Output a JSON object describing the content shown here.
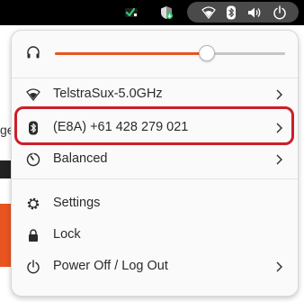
{
  "topbar": {
    "icons": [
      "status-checkmark-icon",
      "shield-update-icon",
      "wifi-icon",
      "bluetooth-icon",
      "speaker-volume-icon",
      "power-icon"
    ]
  },
  "background_app": {
    "partial_text": "ge"
  },
  "quick_settings": {
    "volume": {
      "icon": "headphones-icon",
      "level": 0.66
    },
    "items": [
      {
        "name": "wifi-item",
        "icon": "wifi-icon",
        "label": "TelstraSux-5.0GHz",
        "has_submenu": true
      },
      {
        "name": "bluetooth-item",
        "icon": "bluetooth-icon",
        "label": "(E8A) +61 428 279 021",
        "has_submenu": true,
        "highlighted": true
      },
      {
        "name": "power-mode-item",
        "icon": "power-mode-icon",
        "label": "Balanced",
        "has_submenu": true
      },
      {
        "name": "settings-item",
        "icon": "gear-icon",
        "label": "Settings",
        "has_submenu": false
      },
      {
        "name": "lock-item",
        "icon": "lock-icon",
        "label": "Lock",
        "has_submenu": false
      },
      {
        "name": "power-off-item",
        "icon": "power-icon",
        "label": "Power Off / Log Out",
        "has_submenu": true
      }
    ]
  },
  "colors": {
    "accent": "#e95420",
    "highlight": "#cc1e2b",
    "topbar_bg": "#000000",
    "pill_bg": "#4a4a4a",
    "menu_bg": "#fafafa"
  }
}
